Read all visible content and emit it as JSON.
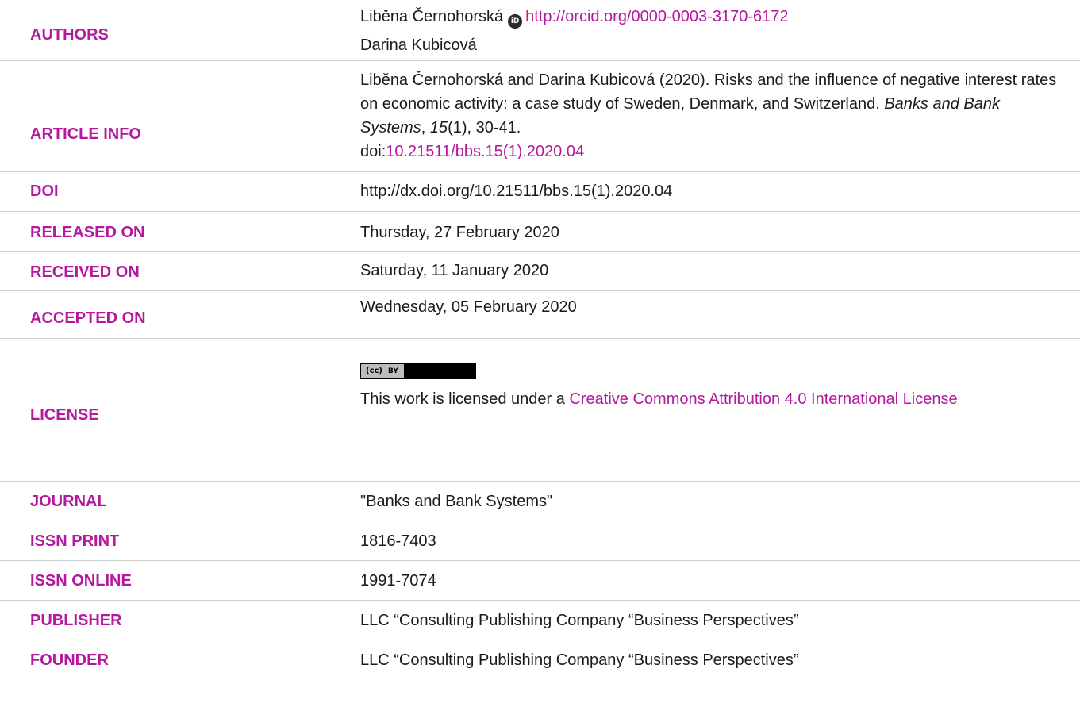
{
  "colors": {
    "accent": "#b5179e",
    "text": "#1a1a1a",
    "divider": "#cfcfcf"
  },
  "authors": {
    "label": "AUTHORS",
    "author1_name": "Liběna Černohorská",
    "orcid_icon_text": "iD",
    "orcid_url": "http://orcid.org/0000-0003-3170-6172",
    "author2_name": "Darina Kubicová"
  },
  "article_info": {
    "label": "ARTICLE INFO",
    "citation_prefix": "Liběna Černohorská and Darina Kubicová (2020). Risks and the influence of negative interest rates on economic activity: a case study of Sweden, Denmark, and Switzerland. ",
    "journal_italic": "Banks and Bank Systems",
    "comma1": ", ",
    "volume_italic": "15",
    "issue_pages": "(1), 30-41.",
    "doi_prefix": "doi:",
    "doi_link": "10.21511/bbs.15(1).2020.04"
  },
  "doi": {
    "label": "DOI",
    "value": "http://dx.doi.org/10.21511/bbs.15(1).2020.04"
  },
  "released_on": {
    "label": "RELEASED ON",
    "value": "Thursday, 27 February 2020"
  },
  "received_on": {
    "label": "RECEIVED ON",
    "value": "Saturday, 11 January 2020"
  },
  "accepted_on": {
    "label": "ACCEPTED ON",
    "value": "Wednesday, 05 February 2020"
  },
  "license": {
    "label": "LICENSE",
    "badge_cc": "(cc)",
    "badge_by": "BY",
    "text_prefix": "This work is licensed under a ",
    "link_text": "Creative Commons Attribution 4.0 International License"
  },
  "journal": {
    "label": "JOURNAL",
    "value": "\"Banks and Bank Systems\""
  },
  "issn_print": {
    "label": "ISSN PRINT",
    "value": "1816-7403"
  },
  "issn_online": {
    "label": "ISSN ONLINE",
    "value": "1991-7074"
  },
  "publisher": {
    "label": "PUBLISHER",
    "value": "LLC “Consulting Publishing Company “Business Perspectives”"
  },
  "founder": {
    "label": "FOUNDER",
    "value": "LLC “Consulting Publishing Company “Business Perspectives”"
  }
}
